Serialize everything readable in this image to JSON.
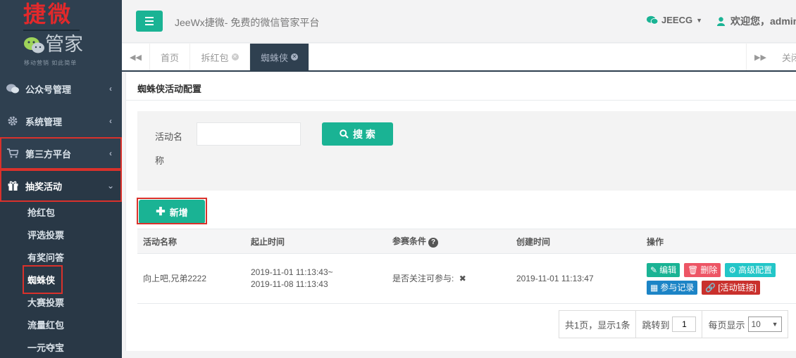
{
  "logo": {
    "main": "捷微",
    "sub": "管家",
    "slogan": "移动营销 如此简单"
  },
  "sidebar": {
    "items": [
      {
        "label": "公众号管理",
        "icon": "wechat-icon"
      },
      {
        "label": "系统管理",
        "icon": "gear-icon"
      },
      {
        "label": "第三方平台",
        "icon": "cart-icon"
      },
      {
        "label": "抽奖活动",
        "icon": "gift-icon"
      }
    ],
    "submenu": [
      "抢红包",
      "评选投票",
      "有奖问答",
      "蜘蛛侠",
      "大赛投票",
      "流量红包",
      "一元夺宝"
    ]
  },
  "header": {
    "title": "JeeWx捷微- 免费的微信管家平台",
    "account": "JEECG",
    "welcome": "欢迎您，admin"
  },
  "tabs": {
    "items": [
      "首页",
      "拆红包",
      "蜘蛛侠"
    ],
    "close_label": "关闭"
  },
  "page": {
    "title": "蜘蛛侠活动配置",
    "search": {
      "label": "活动名称",
      "value": "",
      "button": "搜 索"
    },
    "add_button": "新增",
    "table": {
      "columns": [
        "活动名称",
        "起止时间",
        "参赛条件",
        "创建时间",
        "操作"
      ],
      "rows": [
        {
          "name": "向上吧,兄弟2222",
          "start": "2019-11-01 11:13:43~",
          "end": "2019-11-08 11:13:43",
          "condition": "是否关注可参与:",
          "created": "2019-11-01 11:13:47",
          "actions": {
            "edit": "编辑",
            "delete": "删除",
            "advanced": "高级配置",
            "records": "参与记录",
            "link": "[活动链接]"
          }
        }
      ]
    },
    "pager": {
      "summary": "共1页，显示1条",
      "jump_label": "跳转到",
      "jump_value": "1",
      "per_page_label": "每页显示",
      "per_page_value": "10"
    }
  },
  "colors": {
    "primary": "#1ab394",
    "sidebar": "#2f4050",
    "highlight": "#d9312b"
  }
}
